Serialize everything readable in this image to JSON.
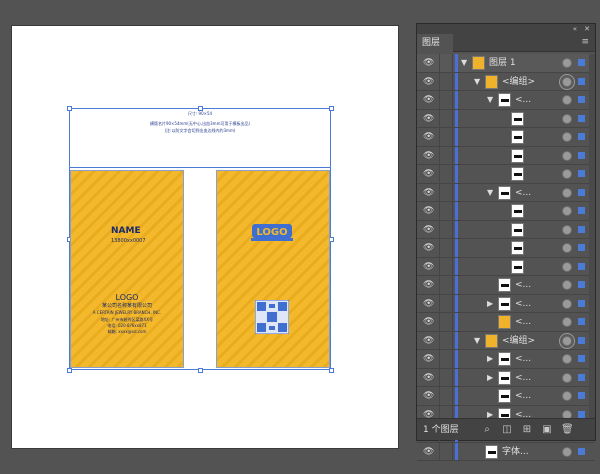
{
  "canvas": {
    "top_text_line1": "尺寸: 90×54",
    "top_text_line2": "横版名片90×54mm(无中心,出血3mm可用于模板出品)",
    "top_text_line3": "(注:以防文字会切到出血边线内约3mm)",
    "card_left": {
      "name": "NAME",
      "phone": "13800xx0007",
      "logo_text": "LOGO",
      "company": "某公司名称某有限公司",
      "company_en": "A CERTAIN JEWELRY BRANCH, INC.",
      "address": "地址: 广州市越秀区某路XX号",
      "phone2": "电话: 020-8?6xx871",
      "email": "邮箱: xxxx@xd.com"
    },
    "card_right": {
      "logo_text": "LOGO"
    }
  },
  "panel": {
    "tab_label": "图层",
    "collapse_icon": "double-chevron-icon",
    "close_icon": "close-icon",
    "menu_icon": "panel-menu-icon",
    "layer_count": "1 个图层",
    "rows": [
      {
        "indent": 0,
        "arrow": "down",
        "thumb": "orange",
        "label": "图层 1",
        "target": "plain",
        "selected": "filled"
      },
      {
        "indent": 1,
        "arrow": "down",
        "thumb": "orange",
        "label": "<编组>",
        "target": "ring",
        "selected": "filled"
      },
      {
        "indent": 2,
        "arrow": "down",
        "thumb": "white",
        "label": "<...",
        "target": "plain",
        "selected": "filled"
      },
      {
        "indent": 3,
        "arrow": "",
        "thumb": "white",
        "label": "",
        "target": "plain",
        "selected": "filled"
      },
      {
        "indent": 3,
        "arrow": "",
        "thumb": "white",
        "label": "",
        "target": "plain",
        "selected": "filled"
      },
      {
        "indent": 3,
        "arrow": "",
        "thumb": "white",
        "label": "",
        "target": "plain",
        "selected": "filled"
      },
      {
        "indent": 3,
        "arrow": "",
        "thumb": "white",
        "label": "",
        "target": "plain",
        "selected": "filled"
      },
      {
        "indent": 2,
        "arrow": "down",
        "thumb": "white",
        "label": "<...",
        "target": "plain",
        "selected": "filled"
      },
      {
        "indent": 3,
        "arrow": "",
        "thumb": "white",
        "label": "",
        "target": "plain",
        "selected": "filled"
      },
      {
        "indent": 3,
        "arrow": "",
        "thumb": "white",
        "label": "",
        "target": "plain",
        "selected": "filled"
      },
      {
        "indent": 3,
        "arrow": "",
        "thumb": "white",
        "label": "",
        "target": "plain",
        "selected": "filled"
      },
      {
        "indent": 3,
        "arrow": "",
        "thumb": "white",
        "label": "",
        "target": "plain",
        "selected": "filled"
      },
      {
        "indent": 2,
        "arrow": "",
        "thumb": "white",
        "label": "<...",
        "target": "plain",
        "selected": "filled"
      },
      {
        "indent": 2,
        "arrow": "right",
        "thumb": "white",
        "label": "<...",
        "target": "plain",
        "selected": "filled"
      },
      {
        "indent": 2,
        "arrow": "",
        "thumb": "orange",
        "label": "<...",
        "target": "plain",
        "selected": "filled"
      },
      {
        "indent": 1,
        "arrow": "down",
        "thumb": "orange",
        "label": "<编组>",
        "target": "ring",
        "selected": "filled"
      },
      {
        "indent": 2,
        "arrow": "right",
        "thumb": "white",
        "label": "<...",
        "target": "plain",
        "selected": "filled"
      },
      {
        "indent": 2,
        "arrow": "right",
        "thumb": "white",
        "label": "<...",
        "target": "plain",
        "selected": "filled"
      },
      {
        "indent": 2,
        "arrow": "",
        "thumb": "white",
        "label": "<...",
        "target": "plain",
        "selected": "filled"
      },
      {
        "indent": 2,
        "arrow": "right",
        "thumb": "white",
        "label": "<...",
        "target": "plain",
        "selected": "filled"
      },
      {
        "indent": 2,
        "arrow": "",
        "thumb": "orange",
        "label": "<...",
        "target": "plain",
        "selected": "filled"
      },
      {
        "indent": 1,
        "arrow": "",
        "thumb": "white",
        "label": "字体...",
        "target": "plain",
        "selected": "filled"
      }
    ],
    "bottom_icons": [
      "locate-icon",
      "make-clipping-mask-icon",
      "new-sublayer-icon",
      "new-layer-icon",
      "delete-icon"
    ]
  }
}
